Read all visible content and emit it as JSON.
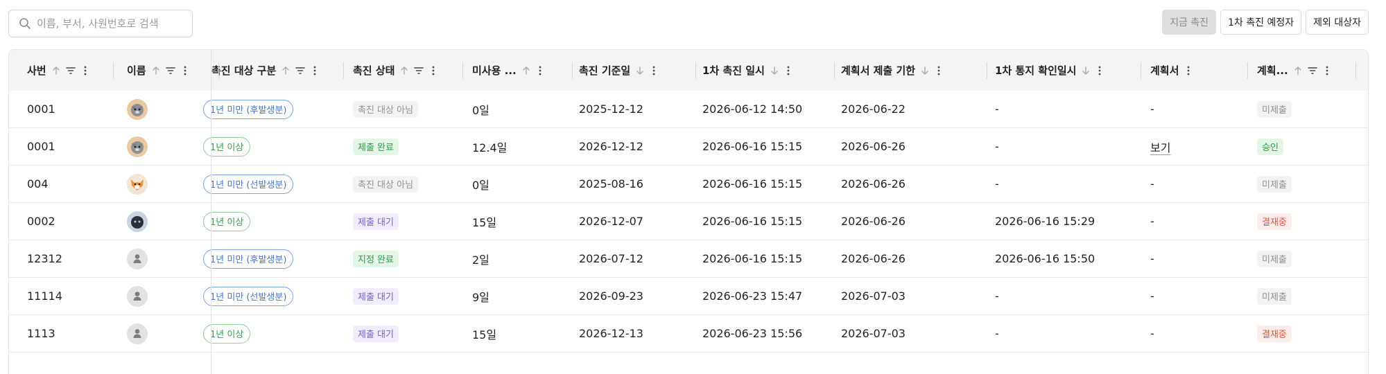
{
  "search": {
    "placeholder": "이름, 부서, 사원번호로 검색"
  },
  "actions": {
    "now_promote": "지금 촉진",
    "first_scheduled": "1차 촉진 예정자",
    "excluded": "제외 대상자"
  },
  "columns": [
    {
      "key": "emp_no",
      "label": "사번"
    },
    {
      "key": "name",
      "label": "이름"
    },
    {
      "key": "target_type",
      "label": "촉진 대상 구분"
    },
    {
      "key": "status",
      "label": "촉진 상태"
    },
    {
      "key": "unused",
      "label": "미사용 ..."
    },
    {
      "key": "base_date",
      "label": "촉진 기준일"
    },
    {
      "key": "first_date",
      "label": "1차 촉진 일시"
    },
    {
      "key": "plan_deadline",
      "label": "계획서 제출 기한"
    },
    {
      "key": "first_confirm",
      "label": "1차 통지 확인일시"
    },
    {
      "key": "plan",
      "label": "계획서"
    },
    {
      "key": "plan_status",
      "label": "계획..."
    }
  ],
  "rows": [
    {
      "emp_no": "0001",
      "avatar": "gray-cat",
      "target_type": "1년 미만 (후발생분)",
      "target_style": "blue",
      "status": "촉진 대상 아님",
      "status_style": "gray",
      "unused": "0일",
      "base_date": "2025-12-12",
      "first_date": "2026-06-12 14:50",
      "plan_deadline": "2026-06-22",
      "first_confirm": "-",
      "plan": "-",
      "plan_link": false,
      "plan_status": "미제출",
      "plan_status_style": "gray"
    },
    {
      "emp_no": "0001",
      "avatar": "gray-cat",
      "target_type": "1년 이상",
      "target_style": "green",
      "status": "제출 완료",
      "status_style": "green",
      "unused": "12.4일",
      "base_date": "2026-12-12",
      "first_date": "2026-06-16 15:15",
      "plan_deadline": "2026-06-26",
      "first_confirm": "-",
      "plan": "보기",
      "plan_link": true,
      "plan_status": "승인",
      "plan_status_style": "green"
    },
    {
      "emp_no": "004",
      "avatar": "orange-fox",
      "target_type": "1년 미만 (선발생분)",
      "target_style": "blue",
      "status": "촉진 대상 아님",
      "status_style": "gray",
      "unused": "0일",
      "base_date": "2025-08-16",
      "first_date": "2026-06-16 15:15",
      "plan_deadline": "2026-06-26",
      "first_confirm": "-",
      "plan": "-",
      "plan_link": false,
      "plan_status": "미제출",
      "plan_status_style": "gray"
    },
    {
      "emp_no": "0002",
      "avatar": "black-cat",
      "target_type": "1년 이상",
      "target_style": "green",
      "status": "제출 대기",
      "status_style": "purple",
      "unused": "15일",
      "base_date": "2026-12-07",
      "first_date": "2026-06-16 15:15",
      "plan_deadline": "2026-06-26",
      "first_confirm": "2026-06-16 15:29",
      "plan": "-",
      "plan_link": false,
      "plan_status": "결재중",
      "plan_status_style": "red"
    },
    {
      "emp_no": "12312",
      "avatar": "default-user",
      "target_type": "1년 미만 (후발생분)",
      "target_style": "blue",
      "status": "지정 완료",
      "status_style": "green",
      "unused": "2일",
      "base_date": "2026-07-12",
      "first_date": "2026-06-16 15:15",
      "plan_deadline": "2026-06-26",
      "first_confirm": "2026-06-16 15:50",
      "plan": "-",
      "plan_link": false,
      "plan_status": "미제출",
      "plan_status_style": "gray"
    },
    {
      "emp_no": "11114",
      "avatar": "default-user",
      "target_type": "1년 미만 (선발생분)",
      "target_style": "blue",
      "status": "제출 대기",
      "status_style": "purple",
      "unused": "9일",
      "base_date": "2026-09-23",
      "first_date": "2026-06-23 15:47",
      "plan_deadline": "2026-07-03",
      "first_confirm": "-",
      "plan": "-",
      "plan_link": false,
      "plan_status": "미제출",
      "plan_status_style": "gray"
    },
    {
      "emp_no": "1113",
      "avatar": "default-user",
      "target_type": "1년 이상",
      "target_style": "green",
      "status": "제출 대기",
      "status_style": "purple",
      "unused": "15일",
      "base_date": "2026-12-13",
      "first_date": "2026-06-23 15:56",
      "plan_deadline": "2026-07-03",
      "first_confirm": "-",
      "plan": "-",
      "plan_link": false,
      "plan_status": "결재중",
      "plan_status_style": "red"
    }
  ]
}
